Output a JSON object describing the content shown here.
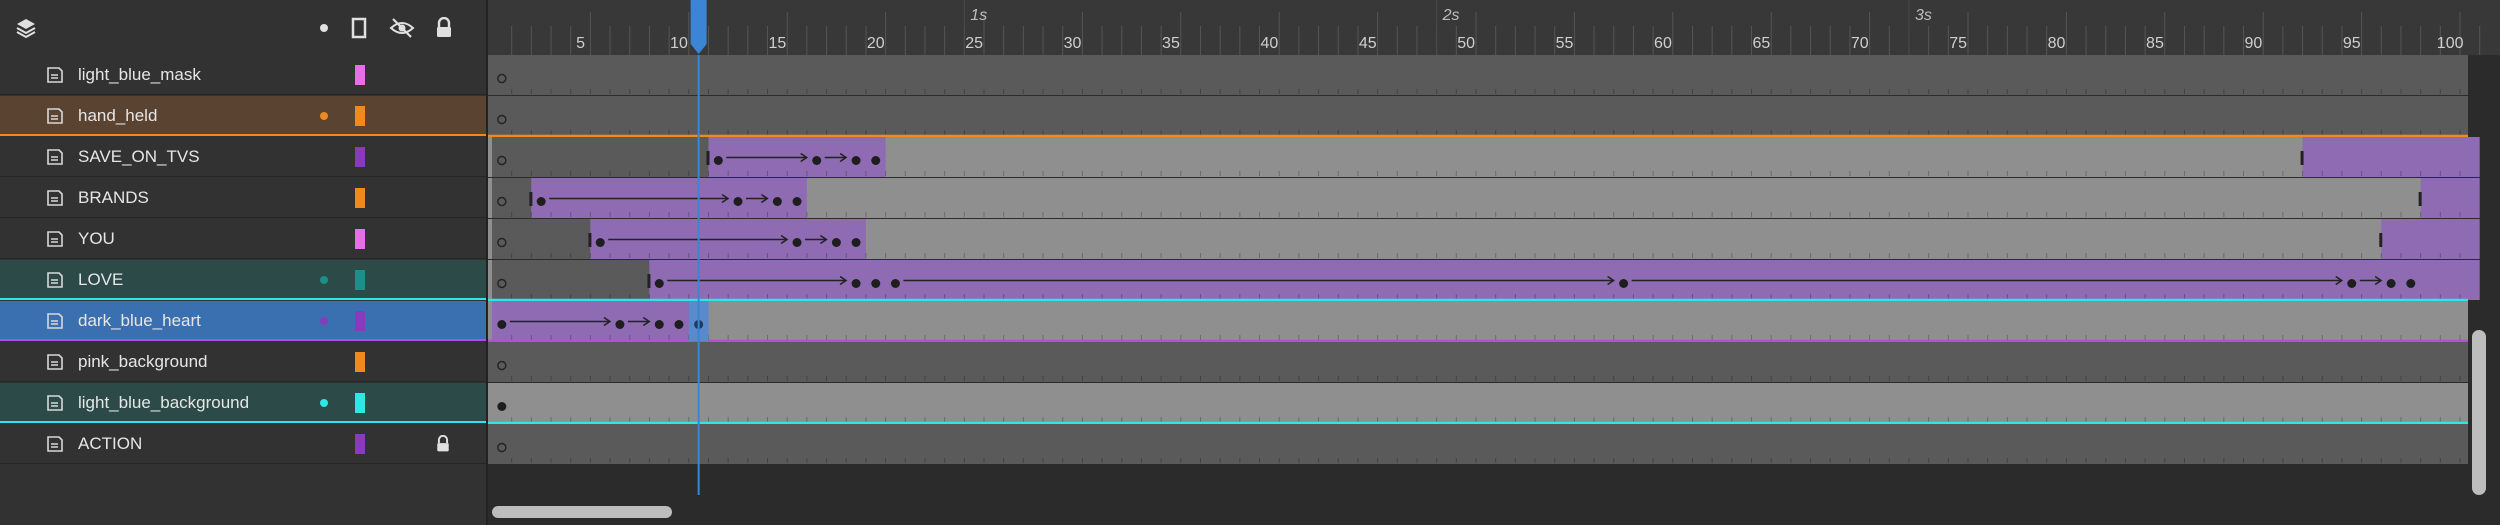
{
  "header": {
    "layers_icon": "layers-stack-icon",
    "show_dot_icon": "dot-icon",
    "outline_icon": "outline-frame-icon",
    "visibility_icon": "eye-slash-icon",
    "lock_icon": "lock-icon"
  },
  "layers": [
    {
      "name": "light_blue_mask",
      "swatch": "#e66fe8",
      "dot": null,
      "highlight": null,
      "locked": false
    },
    {
      "name": "hand_held",
      "swatch": "#f08a1c",
      "dot": "#f08a1c",
      "highlight": "#5a4330",
      "locked": false
    },
    {
      "name": "SAVE_ON_TVS",
      "swatch": "#8a3bbd",
      "dot": null,
      "highlight": null,
      "locked": false
    },
    {
      "name": "BRANDS",
      "swatch": "#f08a1c",
      "dot": null,
      "highlight": null,
      "locked": false
    },
    {
      "name": "YOU",
      "swatch": "#e66fe8",
      "dot": null,
      "highlight": null,
      "locked": false
    },
    {
      "name": "LOVE",
      "swatch": "#1c8f8a",
      "dot": "#1c8f8a",
      "highlight": "#2c4a48",
      "locked": false
    },
    {
      "name": "dark_blue_heart",
      "swatch": "#8a3bbd",
      "dot": "#8a3bbd",
      "highlight": "#3a6fb0",
      "locked": false
    },
    {
      "name": "pink_background",
      "swatch": "#f08a1c",
      "dot": null,
      "highlight": null,
      "locked": false
    },
    {
      "name": "light_blue_background",
      "swatch": "#2ee6e6",
      "dot": "#2ee6e6",
      "highlight": "#2c4a48",
      "locked": false
    },
    {
      "name": "ACTION",
      "swatch": "#8a3bbd",
      "dot": null,
      "highlight": null,
      "locked": true
    }
  ],
  "timeline": {
    "frame_labels": [
      "5",
      "10",
      "15",
      "20",
      "25",
      "30",
      "35",
      "40",
      "45",
      "50",
      "55",
      "60",
      "65",
      "70",
      "75",
      "80",
      "85",
      "90",
      "95",
      "100"
    ],
    "time_labels": [
      "1s",
      "2s",
      "3s"
    ],
    "current_frame": 11
  },
  "colors": {
    "panel_bg": "#323232",
    "tween_purple": "#8e6bb3",
    "playhead_blue": "#3b86d4",
    "orange_line": "#f08a1c",
    "cyan_line": "#2ee6e6",
    "purple_line": "#b44fd6"
  }
}
